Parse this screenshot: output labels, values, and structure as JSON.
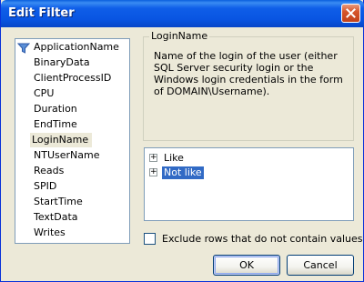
{
  "window": {
    "title": "Edit Filter"
  },
  "columns": {
    "items": [
      "ApplicationName",
      "BinaryData",
      "ClientProcessID",
      "CPU",
      "Duration",
      "EndTime",
      "LoginName",
      "NTUserName",
      "Reads",
      "SPID",
      "StartTime",
      "TextData",
      "Writes"
    ],
    "selected": "LoginName",
    "filtered_icon": "filter-funnel-icon"
  },
  "description": {
    "title": "LoginName",
    "text": "Name of the login of the user (either SQL Server security login or the Windows login credentials in the form of DOMAIN\\Username)."
  },
  "operators": {
    "items": [
      {
        "label": "Like",
        "expander": "+"
      },
      {
        "label": "Not like",
        "expander": "+"
      }
    ],
    "selected": "Not like"
  },
  "options": {
    "exclude_label": "Exclude rows that do not contain values",
    "exclude_checked": false
  },
  "buttons": {
    "ok": "OK",
    "cancel": "Cancel"
  },
  "colors": {
    "titlebar": "#0955e2",
    "selection": "#316ac5",
    "dialog_bg": "#ece9d8"
  }
}
